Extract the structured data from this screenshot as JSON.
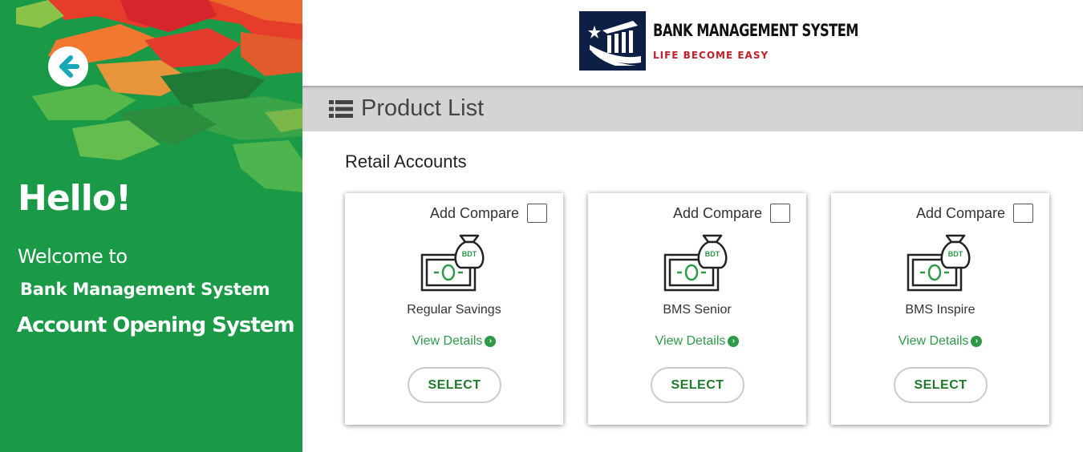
{
  "left_panel": {
    "greeting": "Hello!",
    "welcome": "Welcome to",
    "system_name": "Bank Management System",
    "subtitle": "Account Opening System",
    "back_icon": "arrow-left-icon"
  },
  "brand": {
    "name": "BANK MANAGEMENT SYSTEM",
    "tagline": "LIFE BECOME EASY"
  },
  "product_list": {
    "title": "Product List",
    "icon": "list-icon",
    "section_title": "Retail Accounts"
  },
  "products": [
    {
      "compare_label": "Add Compare",
      "name": "Regular Savings",
      "details_label": "View Details",
      "select_label": "SELECT",
      "currency": "BDT"
    },
    {
      "compare_label": "Add Compare",
      "name": "BMS Senior",
      "details_label": "View Details",
      "select_label": "SELECT",
      "currency": "BDT"
    },
    {
      "compare_label": "Add Compare",
      "name": "BMS Inspire",
      "details_label": "View Details",
      "select_label": "SELECT",
      "currency": "BDT"
    }
  ],
  "colors": {
    "panel_green": "#1a9a47",
    "accent_green": "#2e9a48",
    "brand_navy": "#0d1f44",
    "tagline_red": "#c0202a",
    "back_arrow": "#17a7b8"
  }
}
